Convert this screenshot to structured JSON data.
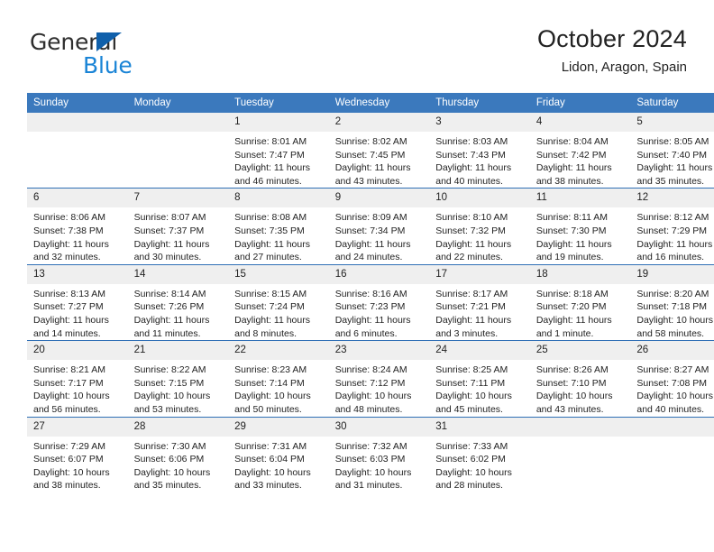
{
  "logo": {
    "word_top": "General",
    "word_bottom": "Blue",
    "triangle_color": "#1060ab",
    "blue_color": "#1a84d6",
    "icon": "general-blue-logo"
  },
  "header": {
    "title": "October 2024",
    "subtitle": "Lidon, Aragon, Spain"
  },
  "theme": {
    "header_bg": "#3b79bd",
    "row_divider": "#2f6fb5",
    "daynum_bg": "#efefef",
    "text": "#222222"
  },
  "calendar": {
    "weekday_headers": [
      "Sunday",
      "Monday",
      "Tuesday",
      "Wednesday",
      "Thursday",
      "Friday",
      "Saturday"
    ],
    "labels": {
      "sunrise": "Sunrise:",
      "sunset": "Sunset:",
      "daylight": "Daylight:"
    },
    "weeks": [
      [
        {
          "day": "",
          "empty": true
        },
        {
          "day": "",
          "empty": true
        },
        {
          "day": "1",
          "sunrise": "Sunrise: 8:01 AM",
          "sunset": "Sunset: 7:47 PM",
          "daylight": "Daylight: 11 hours and 46 minutes."
        },
        {
          "day": "2",
          "sunrise": "Sunrise: 8:02 AM",
          "sunset": "Sunset: 7:45 PM",
          "daylight": "Daylight: 11 hours and 43 minutes."
        },
        {
          "day": "3",
          "sunrise": "Sunrise: 8:03 AM",
          "sunset": "Sunset: 7:43 PM",
          "daylight": "Daylight: 11 hours and 40 minutes."
        },
        {
          "day": "4",
          "sunrise": "Sunrise: 8:04 AM",
          "sunset": "Sunset: 7:42 PM",
          "daylight": "Daylight: 11 hours and 38 minutes."
        },
        {
          "day": "5",
          "sunrise": "Sunrise: 8:05 AM",
          "sunset": "Sunset: 7:40 PM",
          "daylight": "Daylight: 11 hours and 35 minutes."
        }
      ],
      [
        {
          "day": "6",
          "sunrise": "Sunrise: 8:06 AM",
          "sunset": "Sunset: 7:38 PM",
          "daylight": "Daylight: 11 hours and 32 minutes."
        },
        {
          "day": "7",
          "sunrise": "Sunrise: 8:07 AM",
          "sunset": "Sunset: 7:37 PM",
          "daylight": "Daylight: 11 hours and 30 minutes."
        },
        {
          "day": "8",
          "sunrise": "Sunrise: 8:08 AM",
          "sunset": "Sunset: 7:35 PM",
          "daylight": "Daylight: 11 hours and 27 minutes."
        },
        {
          "day": "9",
          "sunrise": "Sunrise: 8:09 AM",
          "sunset": "Sunset: 7:34 PM",
          "daylight": "Daylight: 11 hours and 24 minutes."
        },
        {
          "day": "10",
          "sunrise": "Sunrise: 8:10 AM",
          "sunset": "Sunset: 7:32 PM",
          "daylight": "Daylight: 11 hours and 22 minutes."
        },
        {
          "day": "11",
          "sunrise": "Sunrise: 8:11 AM",
          "sunset": "Sunset: 7:30 PM",
          "daylight": "Daylight: 11 hours and 19 minutes."
        },
        {
          "day": "12",
          "sunrise": "Sunrise: 8:12 AM",
          "sunset": "Sunset: 7:29 PM",
          "daylight": "Daylight: 11 hours and 16 minutes."
        }
      ],
      [
        {
          "day": "13",
          "sunrise": "Sunrise: 8:13 AM",
          "sunset": "Sunset: 7:27 PM",
          "daylight": "Daylight: 11 hours and 14 minutes."
        },
        {
          "day": "14",
          "sunrise": "Sunrise: 8:14 AM",
          "sunset": "Sunset: 7:26 PM",
          "daylight": "Daylight: 11 hours and 11 minutes."
        },
        {
          "day": "15",
          "sunrise": "Sunrise: 8:15 AM",
          "sunset": "Sunset: 7:24 PM",
          "daylight": "Daylight: 11 hours and 8 minutes."
        },
        {
          "day": "16",
          "sunrise": "Sunrise: 8:16 AM",
          "sunset": "Sunset: 7:23 PM",
          "daylight": "Daylight: 11 hours and 6 minutes."
        },
        {
          "day": "17",
          "sunrise": "Sunrise: 8:17 AM",
          "sunset": "Sunset: 7:21 PM",
          "daylight": "Daylight: 11 hours and 3 minutes."
        },
        {
          "day": "18",
          "sunrise": "Sunrise: 8:18 AM",
          "sunset": "Sunset: 7:20 PM",
          "daylight": "Daylight: 11 hours and 1 minute."
        },
        {
          "day": "19",
          "sunrise": "Sunrise: 8:20 AM",
          "sunset": "Sunset: 7:18 PM",
          "daylight": "Daylight: 10 hours and 58 minutes."
        }
      ],
      [
        {
          "day": "20",
          "sunrise": "Sunrise: 8:21 AM",
          "sunset": "Sunset: 7:17 PM",
          "daylight": "Daylight: 10 hours and 56 minutes."
        },
        {
          "day": "21",
          "sunrise": "Sunrise: 8:22 AM",
          "sunset": "Sunset: 7:15 PM",
          "daylight": "Daylight: 10 hours and 53 minutes."
        },
        {
          "day": "22",
          "sunrise": "Sunrise: 8:23 AM",
          "sunset": "Sunset: 7:14 PM",
          "daylight": "Daylight: 10 hours and 50 minutes."
        },
        {
          "day": "23",
          "sunrise": "Sunrise: 8:24 AM",
          "sunset": "Sunset: 7:12 PM",
          "daylight": "Daylight: 10 hours and 48 minutes."
        },
        {
          "day": "24",
          "sunrise": "Sunrise: 8:25 AM",
          "sunset": "Sunset: 7:11 PM",
          "daylight": "Daylight: 10 hours and 45 minutes."
        },
        {
          "day": "25",
          "sunrise": "Sunrise: 8:26 AM",
          "sunset": "Sunset: 7:10 PM",
          "daylight": "Daylight: 10 hours and 43 minutes."
        },
        {
          "day": "26",
          "sunrise": "Sunrise: 8:27 AM",
          "sunset": "Sunset: 7:08 PM",
          "daylight": "Daylight: 10 hours and 40 minutes."
        }
      ],
      [
        {
          "day": "27",
          "sunrise": "Sunrise: 7:29 AM",
          "sunset": "Sunset: 6:07 PM",
          "daylight": "Daylight: 10 hours and 38 minutes."
        },
        {
          "day": "28",
          "sunrise": "Sunrise: 7:30 AM",
          "sunset": "Sunset: 6:06 PM",
          "daylight": "Daylight: 10 hours and 35 minutes."
        },
        {
          "day": "29",
          "sunrise": "Sunrise: 7:31 AM",
          "sunset": "Sunset: 6:04 PM",
          "daylight": "Daylight: 10 hours and 33 minutes."
        },
        {
          "day": "30",
          "sunrise": "Sunrise: 7:32 AM",
          "sunset": "Sunset: 6:03 PM",
          "daylight": "Daylight: 10 hours and 31 minutes."
        },
        {
          "day": "31",
          "sunrise": "Sunrise: 7:33 AM",
          "sunset": "Sunset: 6:02 PM",
          "daylight": "Daylight: 10 hours and 28 minutes."
        },
        {
          "day": "",
          "empty": true
        },
        {
          "day": "",
          "empty": true
        }
      ]
    ]
  }
}
